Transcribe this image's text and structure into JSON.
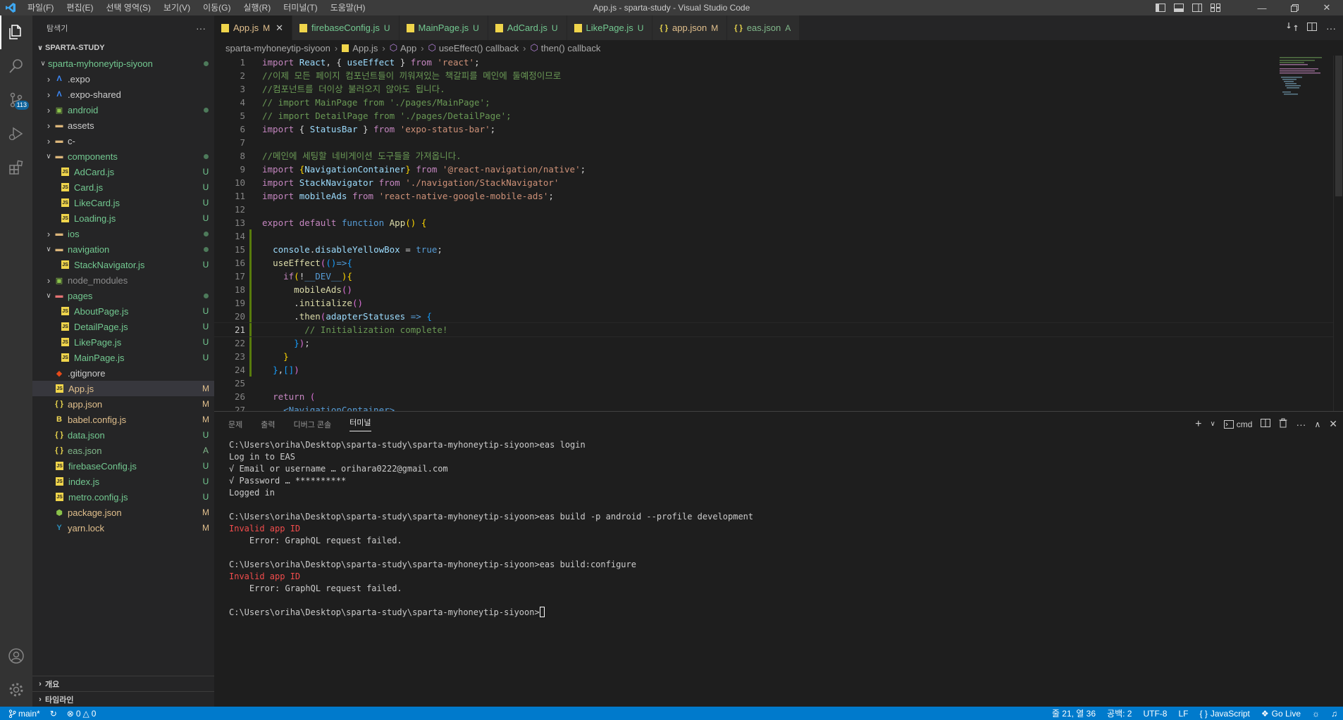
{
  "titlebar": {
    "menu": [
      "파일(F)",
      "편집(E)",
      "선택 영역(S)",
      "보기(V)",
      "이동(G)",
      "실행(R)",
      "터미널(T)",
      "도움말(H)"
    ],
    "title": "App.js - sparta-study - Visual Studio Code"
  },
  "activitybar": {
    "icons": [
      "explorer-icon",
      "search-icon",
      "source-control-icon",
      "run-debug-icon",
      "extensions-icon"
    ],
    "scm_badge": "113",
    "bottom_icons": [
      "account-icon",
      "settings-gear-icon"
    ]
  },
  "sidebar": {
    "title": "탐색기",
    "more": "···",
    "section": "SPARTA-STUDY",
    "tree": [
      {
        "name": "sparta-myhoneytip-siyoon",
        "type": "folder-open",
        "depth": 1,
        "status": "dot",
        "color": "#73c991"
      },
      {
        "name": ".expo",
        "type": "folder",
        "depth": 2,
        "status": "",
        "color": "#cccccc",
        "icon": "expo"
      },
      {
        "name": ".expo-shared",
        "type": "folder",
        "depth": 2,
        "status": "",
        "color": "#cccccc",
        "icon": "expo"
      },
      {
        "name": "android",
        "type": "folder",
        "depth": 2,
        "status": "dot",
        "color": "#73c991",
        "icon": "android"
      },
      {
        "name": "assets",
        "type": "folder",
        "depth": 2,
        "status": "",
        "color": "#cccccc",
        "icon": "folder"
      },
      {
        "name": "c-",
        "type": "folder",
        "depth": 2,
        "status": "",
        "color": "#cccccc",
        "icon": "folder"
      },
      {
        "name": "components",
        "type": "folder-open",
        "depth": 2,
        "status": "dot",
        "color": "#73c991",
        "icon": "folder"
      },
      {
        "name": "AdCard.js",
        "type": "file",
        "depth": 3,
        "status": "U",
        "color": "#73c991",
        "icon": "js"
      },
      {
        "name": "Card.js",
        "type": "file",
        "depth": 3,
        "status": "U",
        "color": "#73c991",
        "icon": "js"
      },
      {
        "name": "LikeCard.js",
        "type": "file",
        "depth": 3,
        "status": "U",
        "color": "#73c991",
        "icon": "js"
      },
      {
        "name": "Loading.js",
        "type": "file",
        "depth": 3,
        "status": "U",
        "color": "#73c991",
        "icon": "js"
      },
      {
        "name": "ios",
        "type": "folder",
        "depth": 2,
        "status": "dot",
        "color": "#73c991",
        "icon": "folder"
      },
      {
        "name": "navigation",
        "type": "folder-open",
        "depth": 2,
        "status": "dot",
        "color": "#73c991",
        "icon": "folder"
      },
      {
        "name": "StackNavigator.js",
        "type": "file",
        "depth": 3,
        "status": "U",
        "color": "#73c991",
        "icon": "js"
      },
      {
        "name": "node_modules",
        "type": "folder",
        "depth": 2,
        "status": "",
        "color": "#8c8c8c",
        "icon": "node"
      },
      {
        "name": "pages",
        "type": "folder-open",
        "depth": 2,
        "status": "dot",
        "color": "#73c991",
        "icon": "folder-red"
      },
      {
        "name": "AboutPage.js",
        "type": "file",
        "depth": 3,
        "status": "U",
        "color": "#73c991",
        "icon": "js"
      },
      {
        "name": "DetailPage.js",
        "type": "file",
        "depth": 3,
        "status": "U",
        "color": "#73c991",
        "icon": "js"
      },
      {
        "name": "LikePage.js",
        "type": "file",
        "depth": 3,
        "status": "U",
        "color": "#73c991",
        "icon": "js"
      },
      {
        "name": "MainPage.js",
        "type": "file",
        "depth": 3,
        "status": "U",
        "color": "#73c991",
        "icon": "js"
      },
      {
        "name": ".gitignore",
        "type": "file",
        "depth": 2,
        "status": "",
        "color": "#cccccc",
        "icon": "git"
      },
      {
        "name": "App.js",
        "type": "file",
        "depth": 2,
        "status": "M",
        "color": "#e2c08d",
        "icon": "js",
        "selected": true
      },
      {
        "name": "app.json",
        "type": "file",
        "depth": 2,
        "status": "M",
        "color": "#e2c08d",
        "icon": "json"
      },
      {
        "name": "babel.config.js",
        "type": "file",
        "depth": 2,
        "status": "M",
        "color": "#e2c08d",
        "icon": "babel"
      },
      {
        "name": "data.json",
        "type": "file",
        "depth": 2,
        "status": "U",
        "color": "#73c991",
        "icon": "json"
      },
      {
        "name": "eas.json",
        "type": "file",
        "depth": 2,
        "status": "A",
        "color": "#81b88b",
        "icon": "json"
      },
      {
        "name": "firebaseConfig.js",
        "type": "file",
        "depth": 2,
        "status": "U",
        "color": "#73c991",
        "icon": "js"
      },
      {
        "name": "index.js",
        "type": "file",
        "depth": 2,
        "status": "U",
        "color": "#73c991",
        "icon": "js"
      },
      {
        "name": "metro.config.js",
        "type": "file",
        "depth": 2,
        "status": "U",
        "color": "#73c991",
        "icon": "js"
      },
      {
        "name": "package.json",
        "type": "file",
        "depth": 2,
        "status": "M",
        "color": "#e2c08d",
        "icon": "npm"
      },
      {
        "name": "yarn.lock",
        "type": "file",
        "depth": 2,
        "status": "M",
        "color": "#e2c08d",
        "icon": "yarn"
      }
    ],
    "outline": "개요",
    "timeline": "타임라인"
  },
  "tabs": [
    {
      "label": "App.js",
      "status": "M",
      "active": true,
      "icon": "JS",
      "color": "#e2c08d"
    },
    {
      "label": "firebaseConfig.js",
      "status": "U",
      "active": false,
      "icon": "JS",
      "color": "#73c991"
    },
    {
      "label": "MainPage.js",
      "status": "U",
      "active": false,
      "icon": "JS",
      "color": "#73c991"
    },
    {
      "label": "AdCard.js",
      "status": "U",
      "active": false,
      "icon": "JS",
      "color": "#73c991"
    },
    {
      "label": "LikePage.js",
      "status": "U",
      "active": false,
      "icon": "JS",
      "color": "#73c991"
    },
    {
      "label": "app.json",
      "status": "M",
      "active": false,
      "icon": "{ }",
      "color": "#e2c08d"
    },
    {
      "label": "eas.json",
      "status": "A",
      "active": false,
      "icon": "{ }",
      "color": "#81b88b"
    }
  ],
  "breadcrumb": [
    "sparta-myhoneytip-siyoon",
    "App.js",
    "App",
    "useEffect() callback",
    "then() callback"
  ],
  "editor": {
    "current_line": 21,
    "lines": [
      [
        [
          "k-purple",
          "import"
        ],
        [
          "",
          " "
        ],
        [
          "k-var",
          "React"
        ],
        [
          "",
          ", { "
        ],
        [
          "k-var",
          "useEffect"
        ],
        [
          "",
          " } "
        ],
        [
          "k-purple",
          "from"
        ],
        [
          "",
          " "
        ],
        [
          "k-str",
          "'react'"
        ],
        [
          "",
          ";"
        ]
      ],
      [
        [
          "k-com",
          "//이제 모든 페이지 컴포넌트들이 끼워져있는 책갈피를 메인에 둘예정이므로"
        ]
      ],
      [
        [
          "k-com",
          "//컴포넌트를 더이상 불러오지 않아도 됩니다."
        ]
      ],
      [
        [
          "k-com",
          "// import MainPage from './pages/MainPage';"
        ]
      ],
      [
        [
          "k-com",
          "// import DetailPage from './pages/DetailPage';"
        ]
      ],
      [
        [
          "k-purple",
          "import"
        ],
        [
          "",
          " { "
        ],
        [
          "k-var",
          "StatusBar"
        ],
        [
          "",
          " } "
        ],
        [
          "k-purple",
          "from"
        ],
        [
          "",
          " "
        ],
        [
          "k-str",
          "'expo-status-bar'"
        ],
        [
          "",
          ";"
        ]
      ],
      [],
      [
        [
          "k-com",
          "//메인에 세팅할 네비게이션 도구들을 가져옵니다."
        ]
      ],
      [
        [
          "k-purple",
          "import"
        ],
        [
          "",
          " "
        ],
        [
          "k-yel",
          "{"
        ],
        [
          "k-var",
          "NavigationContainer"
        ],
        [
          "k-yel",
          "}"
        ],
        [
          "",
          " "
        ],
        [
          "k-purple",
          "from"
        ],
        [
          "",
          " "
        ],
        [
          "k-str",
          "'@react-navigation/native'"
        ],
        [
          "",
          ";"
        ]
      ],
      [
        [
          "k-purple",
          "import"
        ],
        [
          "",
          " "
        ],
        [
          "k-var",
          "StackNavigator"
        ],
        [
          "",
          " "
        ],
        [
          "k-purple",
          "from"
        ],
        [
          "",
          " "
        ],
        [
          "k-str",
          "'./navigation/StackNavigator'"
        ]
      ],
      [
        [
          "k-purple",
          "import"
        ],
        [
          "",
          " "
        ],
        [
          "k-var",
          "mobileAds"
        ],
        [
          "",
          " "
        ],
        [
          "k-purple",
          "from"
        ],
        [
          "",
          " "
        ],
        [
          "k-str",
          "'react-native-google-mobile-ads'"
        ],
        [
          "",
          ";"
        ]
      ],
      [],
      [
        [
          "k-purple",
          "export"
        ],
        [
          "",
          " "
        ],
        [
          "k-purple",
          "default"
        ],
        [
          "",
          " "
        ],
        [
          "k-blue",
          "function"
        ],
        [
          "",
          " "
        ],
        [
          "k-fn",
          "App"
        ],
        [
          "k-yel",
          "()"
        ],
        [
          "",
          " "
        ],
        [
          "k-yel",
          "{"
        ]
      ],
      [],
      [
        [
          "",
          "  "
        ],
        [
          "k-var",
          "console"
        ],
        [
          "",
          "."
        ],
        [
          "k-var",
          "disableYellowBox"
        ],
        [
          "",
          " = "
        ],
        [
          "k-blue",
          "true"
        ],
        [
          "",
          ";"
        ]
      ],
      [
        [
          "",
          "  "
        ],
        [
          "k-fn",
          "useEffect"
        ],
        [
          "k-pink",
          "("
        ],
        [
          "k-cyan",
          "()"
        ],
        [
          "k-blue",
          "=>"
        ],
        [
          "k-cyan",
          "{"
        ]
      ],
      [
        [
          "",
          "    "
        ],
        [
          "k-purple",
          "if"
        ],
        [
          "k-yel",
          "("
        ],
        [
          "",
          "!"
        ],
        [
          "k-blue",
          "__DEV__"
        ],
        [
          "k-yel",
          "){"
        ]
      ],
      [
        [
          "",
          "      "
        ],
        [
          "k-fn",
          "mobileAds"
        ],
        [
          "k-pink",
          "()"
        ]
      ],
      [
        [
          "",
          "      ."
        ],
        [
          "k-fn",
          "initialize"
        ],
        [
          "k-pink",
          "()"
        ]
      ],
      [
        [
          "",
          "      ."
        ],
        [
          "k-fn",
          "then"
        ],
        [
          "k-pink",
          "("
        ],
        [
          "k-var",
          "adapterStatuses"
        ],
        [
          "",
          " "
        ],
        [
          "k-blue",
          "=>"
        ],
        [
          "",
          " "
        ],
        [
          "k-cyan",
          "{"
        ]
      ],
      [
        [
          "",
          "        "
        ],
        [
          "k-com",
          "// Initialization complete!"
        ]
      ],
      [
        [
          "",
          "      "
        ],
        [
          "k-cyan",
          "}"
        ],
        [
          "k-pink",
          ")"
        ],
        [
          "",
          ";"
        ]
      ],
      [
        [
          "",
          "    "
        ],
        [
          "k-yel",
          "}"
        ]
      ],
      [
        [
          "",
          "  "
        ],
        [
          "k-cyan",
          "}"
        ],
        [
          "",
          ","
        ],
        [
          "k-cyan",
          "[]"
        ],
        [
          "k-pink",
          ")"
        ]
      ],
      [],
      [
        [
          "",
          "  "
        ],
        [
          "k-purple",
          "return"
        ],
        [
          "",
          " "
        ],
        [
          "k-pink",
          "("
        ]
      ],
      [
        [
          "",
          "    "
        ],
        [
          "k-blue",
          "<NavigationContainer>"
        ]
      ]
    ]
  },
  "panel": {
    "tabs": [
      "문제",
      "출력",
      "디버그 콘솔",
      "터미널"
    ],
    "active_tab": "터미널",
    "shell": "cmd",
    "terminal": [
      {
        "t": "C:\\Users\\oriha\\Desktop\\sparta-study\\sparta-myhoneytip-siyoon>eas login",
        "c": ""
      },
      {
        "t": "Log in to EAS",
        "c": ""
      },
      {
        "t": "√ Email or username … orihara0222@gmail.com",
        "c": ""
      },
      {
        "t": "√ Password … **********",
        "c": ""
      },
      {
        "t": "Logged in",
        "c": ""
      },
      {
        "t": "",
        "c": ""
      },
      {
        "t": "C:\\Users\\oriha\\Desktop\\sparta-study\\sparta-myhoneytip-siyoon>eas build -p android --profile development",
        "c": ""
      },
      {
        "t": "Invalid app ID",
        "c": "err"
      },
      {
        "t": "    Error: GraphQL request failed.",
        "c": ""
      },
      {
        "t": "",
        "c": ""
      },
      {
        "t": "C:\\Users\\oriha\\Desktop\\sparta-study\\sparta-myhoneytip-siyoon>eas build:configure",
        "c": ""
      },
      {
        "t": "Invalid app ID",
        "c": "err"
      },
      {
        "t": "    Error: GraphQL request failed.",
        "c": ""
      },
      {
        "t": "",
        "c": ""
      },
      {
        "t": "C:\\Users\\oriha\\Desktop\\sparta-study\\sparta-myhoneytip-siyoon>",
        "c": "prompt"
      }
    ]
  },
  "statusbar": {
    "branch": "main*",
    "errors": "0",
    "warnings": "0",
    "position": "줄 21, 열 36",
    "spaces": "공백: 2",
    "encoding": "UTF-8",
    "eol": "LF",
    "language": "JavaScript",
    "golive": "Go Live"
  },
  "colors": {
    "accent": "#007acc",
    "untracked": "#73c991",
    "modified": "#e2c08d",
    "added": "#81b88b",
    "error": "#f14c4c"
  }
}
